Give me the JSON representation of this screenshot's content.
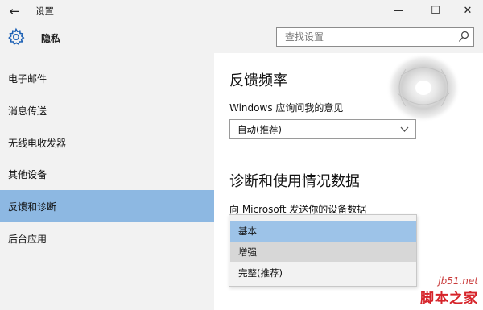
{
  "window": {
    "title": "设置",
    "back_glyph": "←",
    "min_glyph": "—",
    "max_glyph": "☐",
    "close_glyph": "✕"
  },
  "header": {
    "section_title": "隐私",
    "search_placeholder": "查找设置"
  },
  "sidebar": {
    "items": [
      {
        "label": "电子邮件",
        "selected": false
      },
      {
        "label": "消息传送",
        "selected": false
      },
      {
        "label": "无线电收发器",
        "selected": false
      },
      {
        "label": "其他设备",
        "selected": false
      },
      {
        "label": "反馈和诊断",
        "selected": true
      },
      {
        "label": "后台应用",
        "selected": false
      }
    ]
  },
  "main": {
    "feedback_heading": "反馈频率",
    "feedback_label": "Windows 应询问我的意见",
    "feedback_selected": "自动(推荐)",
    "diag_heading": "诊断和使用情况数据",
    "diag_label": "向 Microsoft 发送你的设备数据",
    "diag_options": [
      "基本",
      "增强",
      "完整(推荐)"
    ]
  },
  "watermark": {
    "url": "jb51.net",
    "brand": "脚本之家"
  },
  "colors": {
    "chrome": "#f2f2f2",
    "selected": "#8db8e2",
    "dropdown_highlight": "#9dc3e8"
  }
}
